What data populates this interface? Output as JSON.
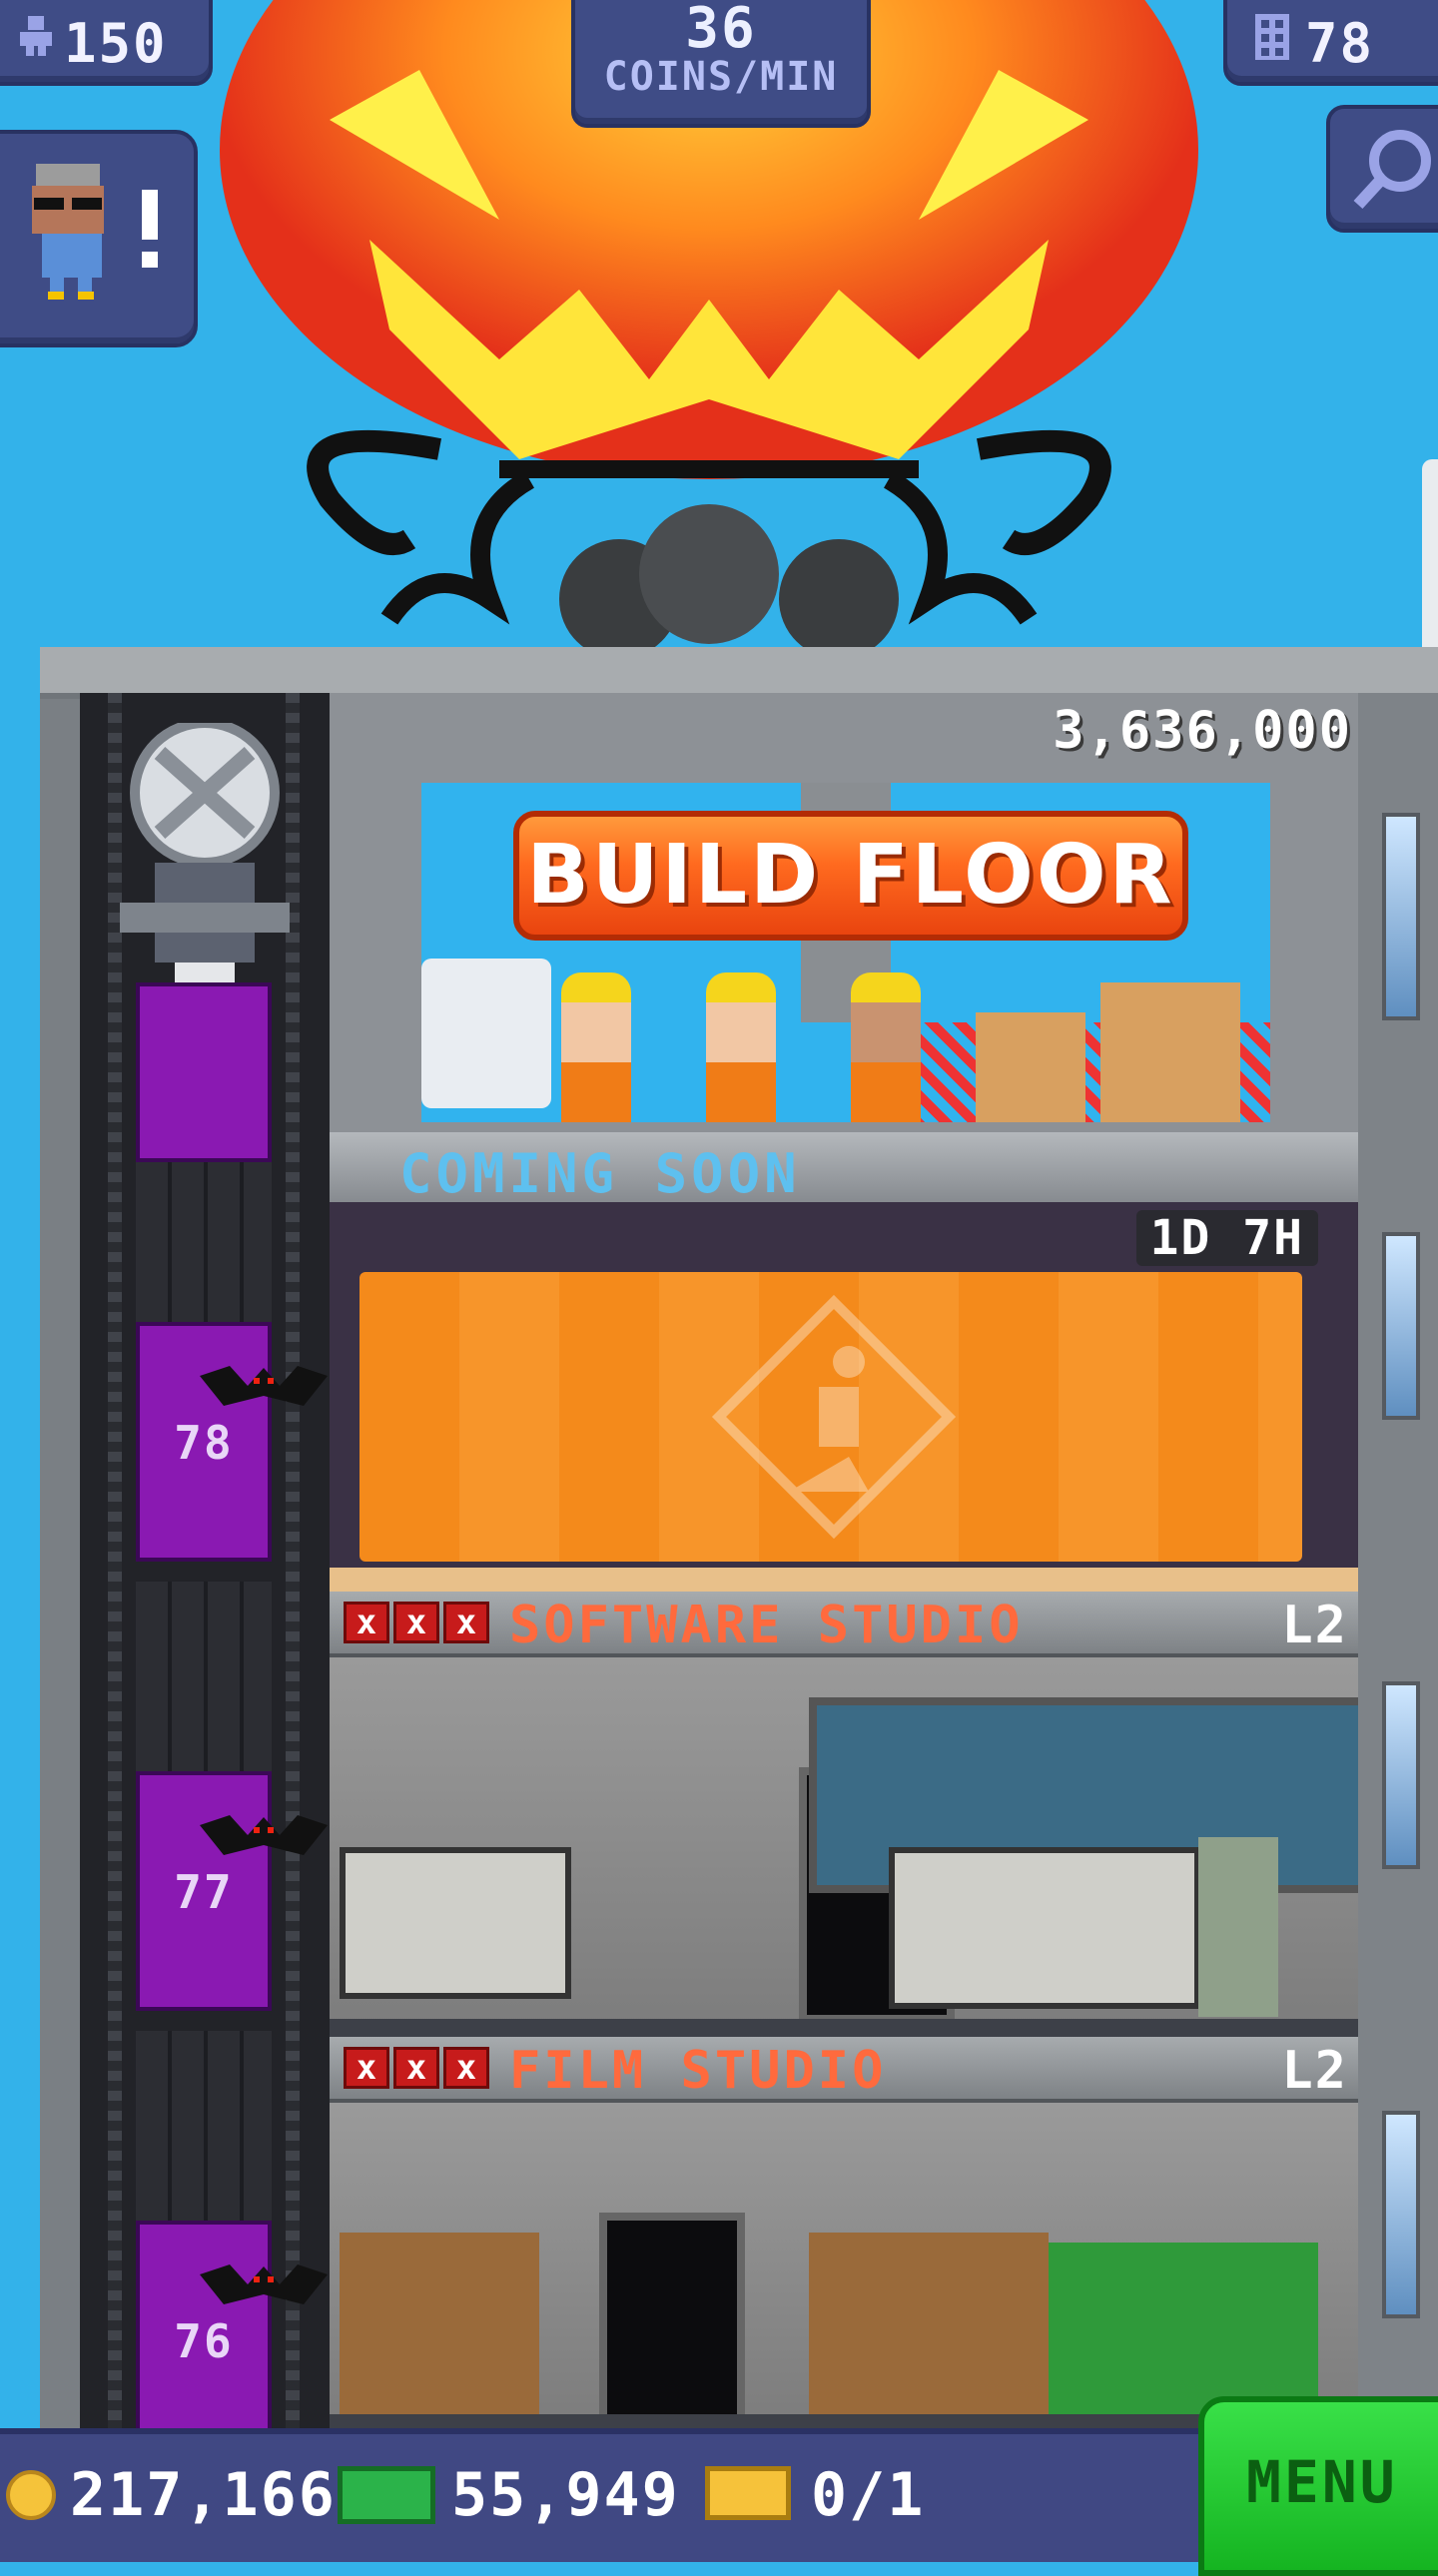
{
  "hud": {
    "population": "150",
    "coins_per_min_value": "36",
    "coins_per_min_label": "COINS/MIN",
    "floor_count": "78"
  },
  "build": {
    "cost": "3,636,000",
    "button_label": "BUILD FLOOR"
  },
  "coming_soon": {
    "label": "COMING SOON",
    "timer": "1D 7H"
  },
  "floors": [
    {
      "number": "78",
      "name": "",
      "level": ""
    },
    {
      "number": "77",
      "name": "SOFTWARE STUDIO",
      "level": "L2"
    },
    {
      "number": "76",
      "name": "FILM STUDIO",
      "level": "L2"
    }
  ],
  "bottom": {
    "coins": "217,166",
    "bux": "55,949",
    "tickets": "0/1",
    "menu_label": "MENU"
  },
  "colors": {
    "sky": "#33b2ea",
    "hud_panel": "#3f4c86",
    "build_button": "#ff6a1f",
    "elevator": "#8a19b2",
    "floor_name": "#ff6a3d",
    "menu": "#15b421"
  },
  "icons": {
    "population": "person-icon",
    "floors": "building-icon",
    "zoom": "magnifier-icon",
    "coins": "coin-icon",
    "bux": "bux-icon",
    "tickets": "ticket-icon"
  }
}
